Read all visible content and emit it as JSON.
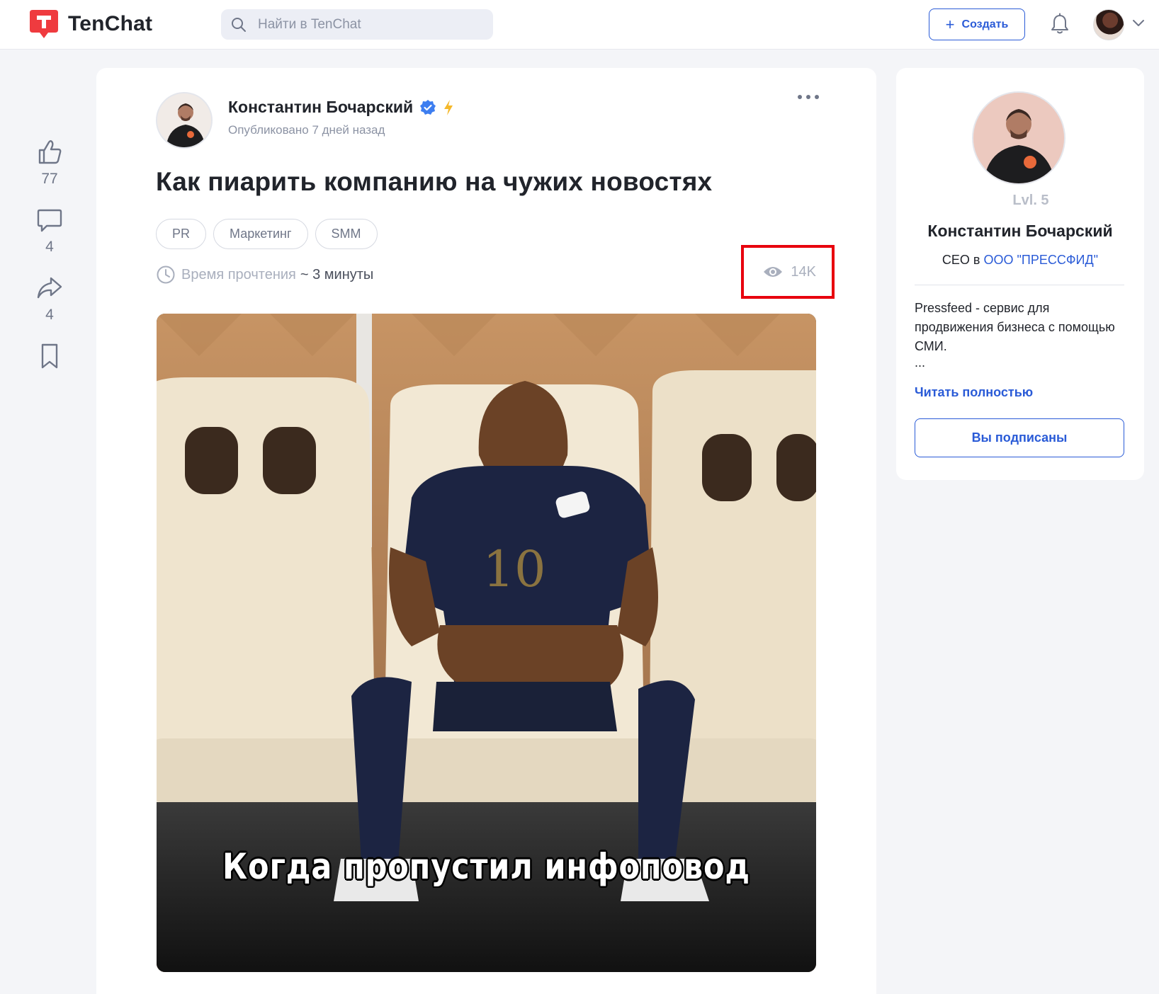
{
  "header": {
    "brand": "TenChat",
    "search_placeholder": "Найти в TenChat",
    "create_label": "Создать"
  },
  "actions": {
    "likes": "77",
    "comments": "4",
    "shares": "4"
  },
  "post": {
    "author": "Константин Бочарский",
    "published": "Опубликовано 7 дней назад",
    "title": "Как пиарить компанию на чужих новостях",
    "tags": [
      "PR",
      "Маркетинг",
      "SMM"
    ],
    "read_time_label": "Время прочтения",
    "read_time_value": "~ 3 минуты",
    "views": "14K",
    "image_caption": "Когда пропустил инфоповод"
  },
  "profile": {
    "level": "Lvl. 5",
    "name": "Константин Бочарский",
    "role_prefix": "CEO в",
    "company": "ООО \"ПРЕССФИД\"",
    "bio": "Pressfeed - сервис для продвижения бизнеса с помощью СМИ.",
    "bio_ellipsis": "...",
    "read_more": "Читать полностью",
    "subscribe_state": "Вы подписаны"
  },
  "colors": {
    "accent": "#2a5bd7",
    "brand_red": "#ef3b3f",
    "highlight_box": "#e8000d",
    "verified": "#3d7ef0",
    "bolt": "#f5b82a"
  }
}
